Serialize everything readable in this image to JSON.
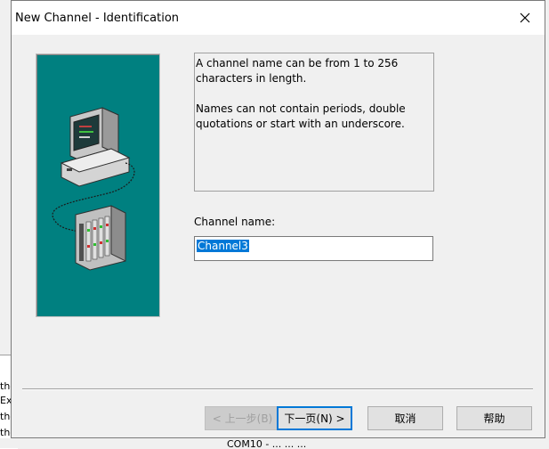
{
  "window": {
    "title": "New Channel - Identification",
    "close_label": "✕"
  },
  "info": {
    "line1": "A channel name can be from 1 to 256",
    "line2": "characters in length.",
    "line3": "Names can not contain periods, double",
    "line4": "quotations or start with an underscore."
  },
  "form": {
    "label": "Channel name:",
    "value": "Channel3"
  },
  "buttons": {
    "back": "< 上一步(B)",
    "next": "下一页(N) >",
    "cancel": "取消",
    "help": "帮助"
  },
  "background": {
    "lines": [
      "the",
      "Ex",
      "the",
      "the"
    ],
    "bottom_text": "COM10 - ... ... ..."
  },
  "colors": {
    "panel": "#008080",
    "selection": "#0078d7",
    "dialog_bg": "#f0f0f0"
  },
  "icons": [
    "close-icon",
    "computer-icon",
    "io-rack-icon"
  ]
}
